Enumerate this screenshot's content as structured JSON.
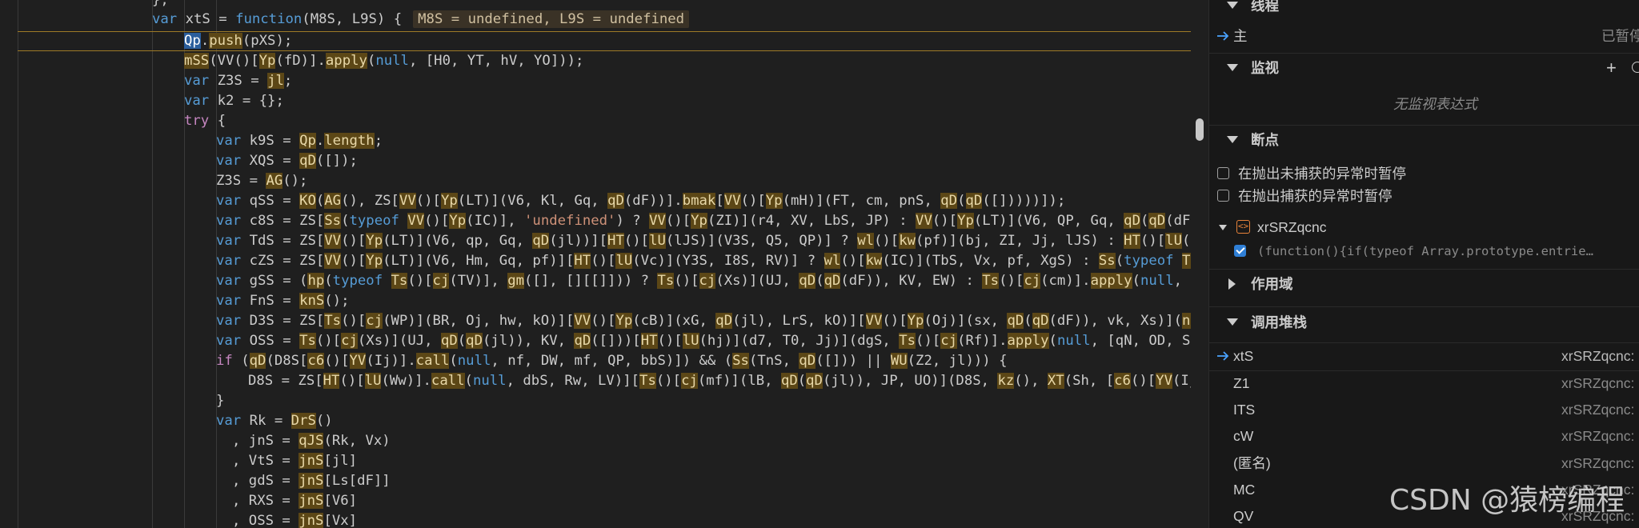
{
  "editor": {
    "inline_values": "M8S = undefined, L9S = undefined"
  },
  "sidebar": {
    "threads": {
      "header": "线程",
      "main_thread": "主",
      "main_status": "已暂停"
    },
    "watch": {
      "header": "监视",
      "empty": "无监视表达式"
    },
    "breakpoints": {
      "header": "断点",
      "uncaught_label": "在抛出未捕获的异常时暂停",
      "caught_label": "在抛出捕获的异常时暂停",
      "file_name": "xrSRZqcnc",
      "bp_code": "(function(){if(typeof Array.prototype.entrie…"
    },
    "scope": {
      "header": "作用域"
    },
    "call_stack": {
      "header": "调用堆栈",
      "frames": [
        {
          "name": "xtS",
          "file": "xrSRZqcnc:"
        },
        {
          "name": "Z1",
          "file": "xrSRZqcnc:"
        },
        {
          "name": "ITS",
          "file": "xrSRZqcnc:"
        },
        {
          "name": "cW",
          "file": "xrSRZqcnc:"
        },
        {
          "name": "(匿名)",
          "file": "xrSRZqcnc:"
        },
        {
          "name": "MC",
          "file": "xrSRZqcnc:"
        },
        {
          "name": "QV",
          "file": "xrSRZqcnc:"
        }
      ]
    }
  },
  "watermark": "CSDN @猿榜编程"
}
